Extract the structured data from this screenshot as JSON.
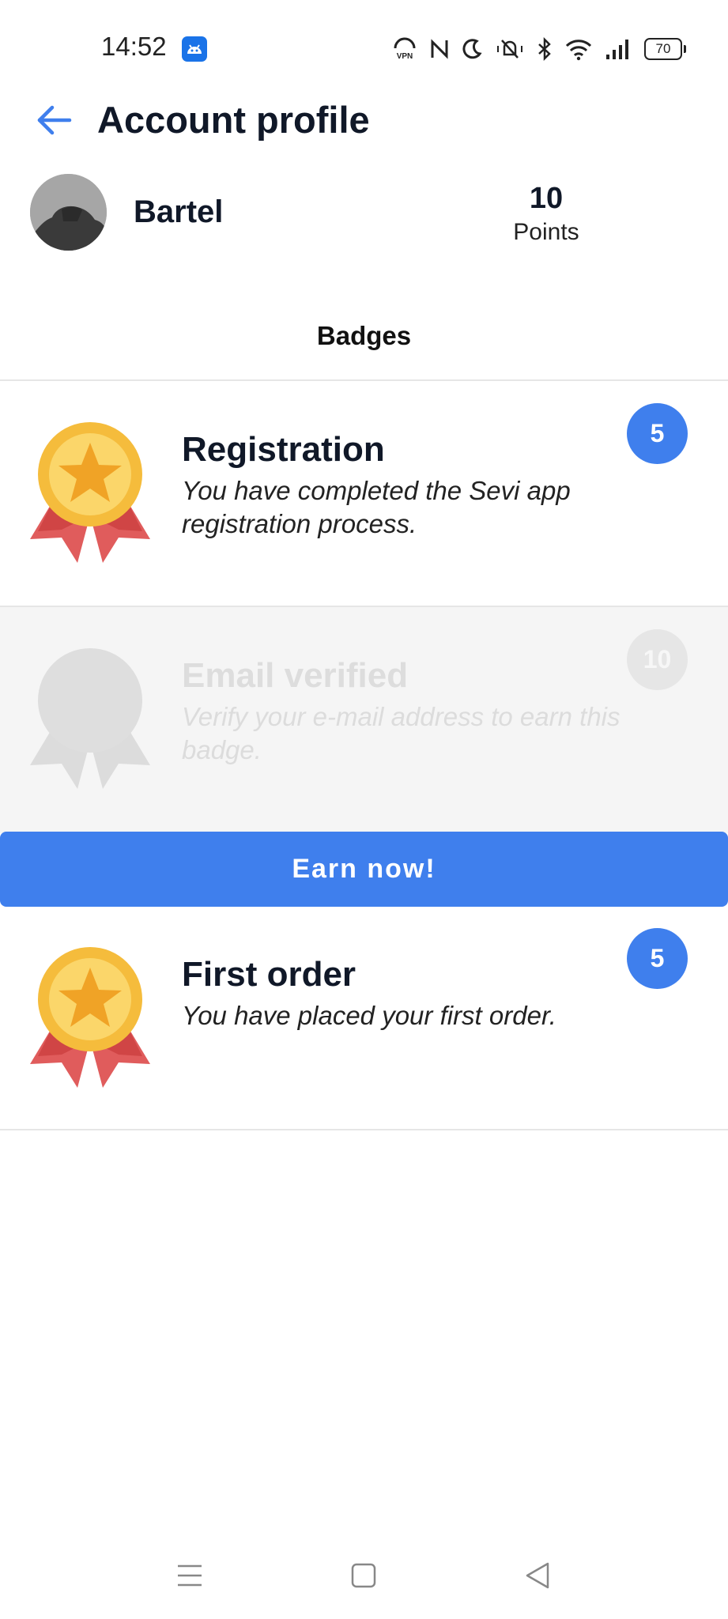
{
  "status_bar": {
    "time": "14:52",
    "notification_icon": "android-icon",
    "icons": [
      "vpn-icon",
      "nfc-icon",
      "moon-icon",
      "mute-icon",
      "bluetooth-icon",
      "wifi-icon",
      "signal-icon"
    ],
    "battery": "70"
  },
  "header": {
    "title": "Account profile",
    "back_icon": "arrow-left-icon",
    "accent": "#3f7fed"
  },
  "profile": {
    "name": "Bartel",
    "points_value": "10",
    "points_label": "Points"
  },
  "tabs": {
    "badges": "Badges"
  },
  "badges": [
    {
      "title": "Registration",
      "description": "You have completed the Sevi app registration process.",
      "points": "5",
      "state": "earned"
    },
    {
      "title": "Email verified",
      "description": "Verify your e-mail address to earn this badge.",
      "points": "10",
      "state": "locked",
      "action": "Earn now!"
    },
    {
      "title": "First order",
      "description": "You have placed your first order.",
      "points": "5",
      "state": "earned"
    }
  ],
  "nav_bar": {
    "icons": [
      "menu-icon",
      "home-square-icon",
      "back-triangle-icon"
    ]
  }
}
